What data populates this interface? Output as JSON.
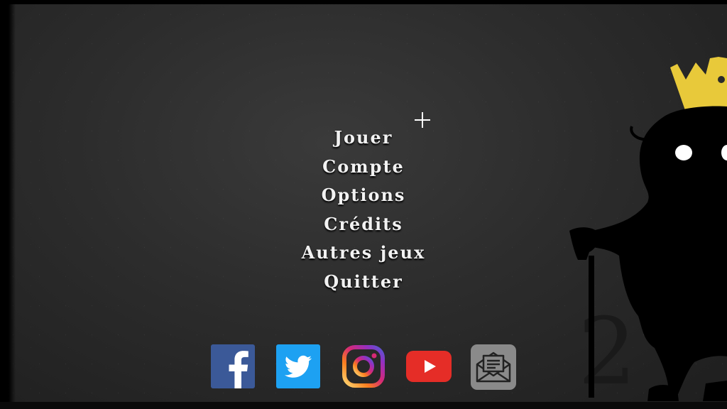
{
  "menu": {
    "items": [
      {
        "label": "Jouer"
      },
      {
        "label": "Compte"
      },
      {
        "label": "Options"
      },
      {
        "label": "Crédits"
      },
      {
        "label": "Autres jeux"
      },
      {
        "label": "Quitter"
      }
    ]
  },
  "social": {
    "icons": [
      "facebook-icon",
      "twitter-icon",
      "instagram-icon",
      "youtube-icon",
      "mail-icon"
    ]
  },
  "decor": {
    "chapter_number": "2",
    "crown_color": "#e8c93a",
    "background_color": "#2c2c2c",
    "menu_text_color": "#f2f2f2"
  }
}
